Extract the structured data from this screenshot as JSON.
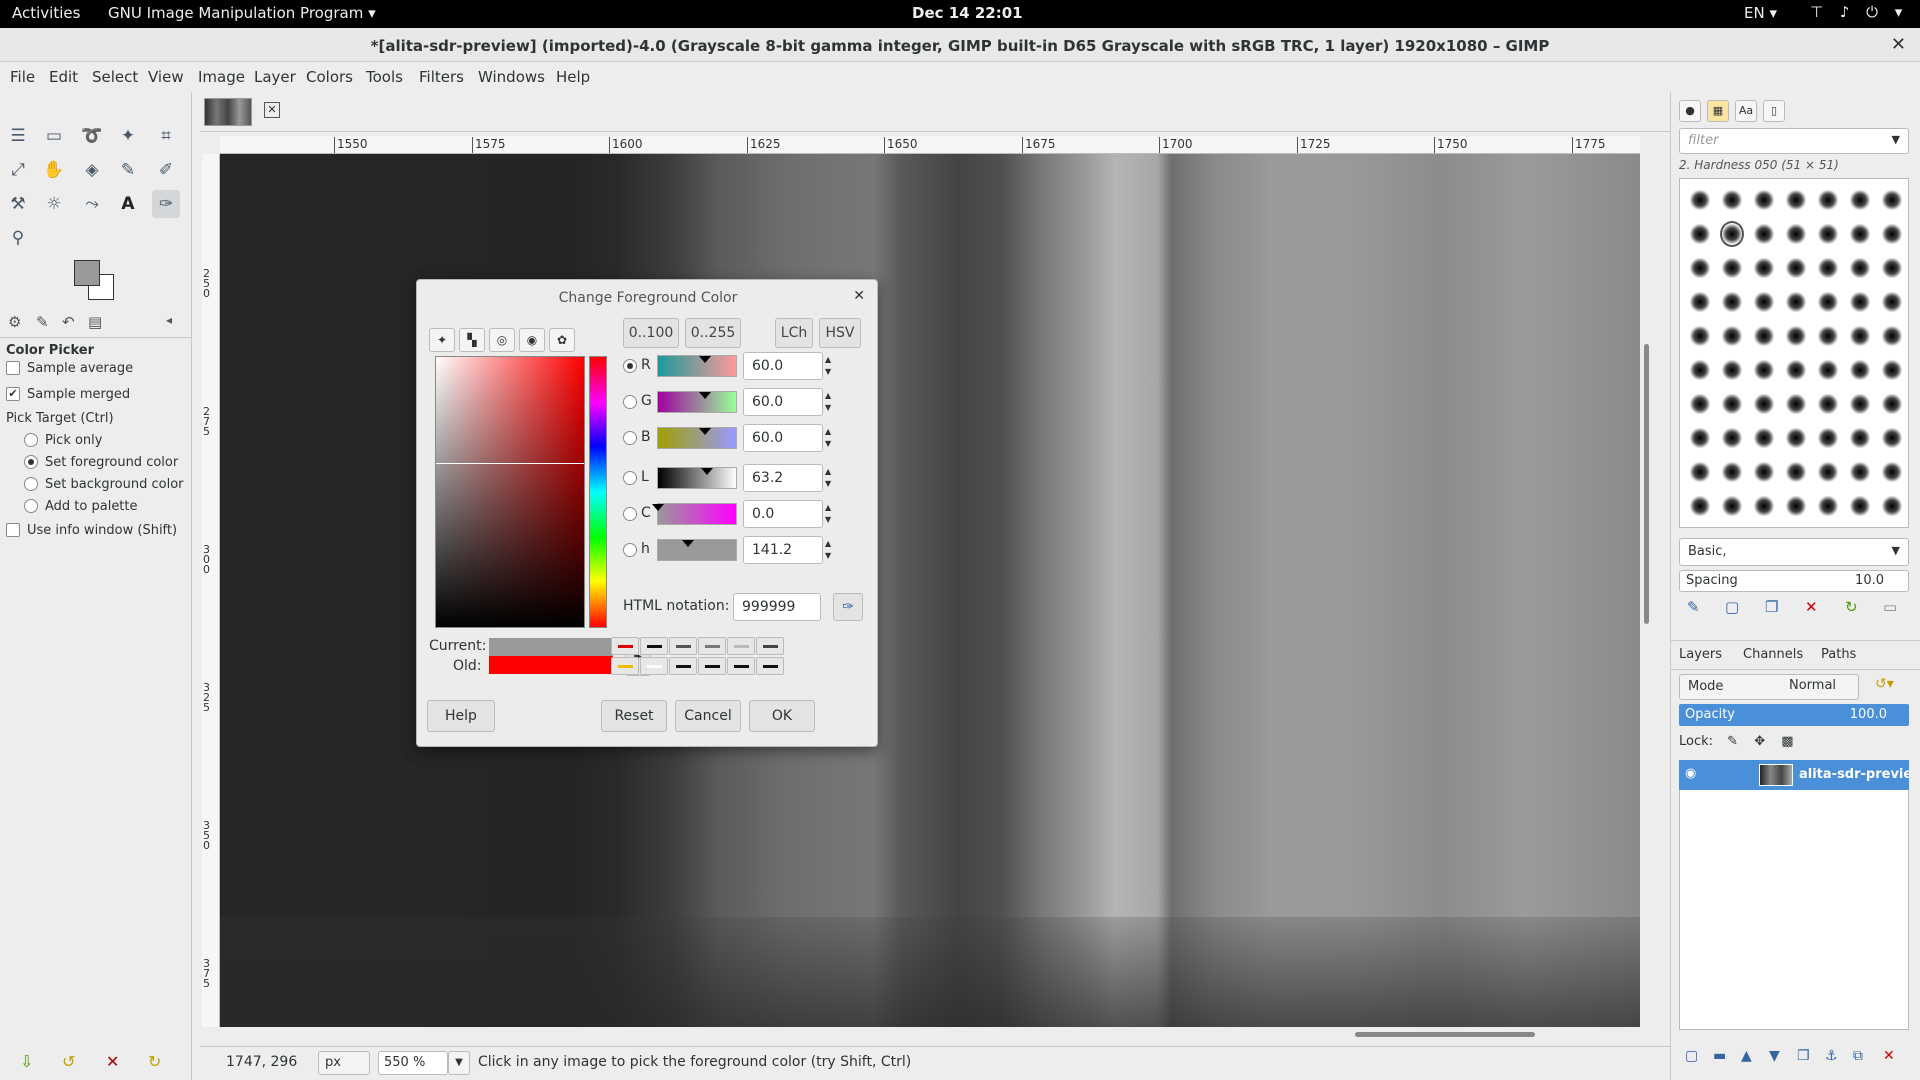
{
  "topbar": {
    "activities": "Activities",
    "app_menu": "GNU Image Manipulation Program ▾",
    "clock": "Dec 14  22:01",
    "lang": "EN ▾",
    "sys_icons": "⊤ ♪ ⏻ ▾"
  },
  "window": {
    "title": "*[alita-sdr-preview] (imported)-4.0 (Grayscale 8-bit gamma integer, GIMP built-in D65 Grayscale with sRGB TRC, 1 layer) 1920x1080 – GIMP",
    "close": "✕"
  },
  "menu": [
    "File",
    "Edit",
    "Select",
    "View",
    "Image",
    "Layer",
    "Colors",
    "Tools",
    "Filters",
    "Windows",
    "Help"
  ],
  "tool_options": {
    "title": "Color Picker",
    "sample_average": "Sample average",
    "sample_merged": "Sample merged",
    "pick_target": "Pick Target  (Ctrl)",
    "pick_only": "Pick only",
    "set_fg": "Set foreground color",
    "set_bg": "Set background color",
    "add_palette": "Add to palette",
    "use_info": "Use info window  (Shift)"
  },
  "ruler": {
    "h": [
      "1550",
      "1575",
      "1600",
      "1625",
      "1650",
      "1675",
      "1700",
      "1725",
      "1750",
      "1775"
    ],
    "v": [
      "250",
      "275",
      "300",
      "325",
      "350",
      "375"
    ]
  },
  "status": {
    "coords": "1747, 296",
    "unit": "px",
    "zoom": "550 %",
    "message": "Click in any image to pick the foreground color (try Shift, Ctrl)"
  },
  "brushes": {
    "filter_placeholder": "filter",
    "current": "2. Hardness 050 (51 × 51)",
    "preset": "Basic,",
    "spacing_label": "Spacing",
    "spacing_value": "10.0"
  },
  "layers": {
    "tabs": [
      "Layers",
      "Channels",
      "Paths"
    ],
    "mode_label": "Mode",
    "mode_value": "Normal",
    "opacity_label": "Opacity",
    "opacity_value": "100.0",
    "lock_label": "Lock:",
    "layer_name": "alita-sdr-preview.png"
  },
  "dialog": {
    "title": "Change Foreground Color",
    "scale_100": "0..100",
    "scale_255": "0..255",
    "lch": "LCh",
    "hsv": "HSV",
    "channels": [
      {
        "label": "R",
        "value": "60.0",
        "colors": [
          "#1a9b9b",
          "#ff9999"
        ],
        "marker_pct": 60
      },
      {
        "label": "G",
        "value": "60.0",
        "colors": [
          "#a000a0",
          "#99ff99"
        ],
        "marker_pct": 60
      },
      {
        "label": "B",
        "value": "60.0",
        "colors": [
          "#a0a000",
          "#9999ff"
        ],
        "marker_pct": 60
      },
      {
        "label": "L",
        "value": "63.2",
        "colors": [
          "#000000",
          "#ffffff"
        ],
        "marker_pct": 63
      },
      {
        "label": "C",
        "value": "0.0",
        "colors": [
          "#999999",
          "#ff00ff"
        ],
        "marker_pct": 0
      },
      {
        "label": "h",
        "value": "141.2",
        "colors": [
          "#999999",
          "#999999"
        ],
        "marker_pct": 39
      }
    ],
    "html_label": "HTML notation:",
    "html_value": "999999",
    "current_label": "Current:",
    "old_label": "Old:",
    "current_color": "#999999",
    "old_color": "#ff0000",
    "history_colors": [
      "#e00000",
      "#111111",
      "#555555",
      "#777777",
      "#bbbbbb",
      "#444444",
      "#e8c000",
      "#ffffff",
      "#111111",
      "#111111",
      "#111111",
      "#111111"
    ],
    "help": "Help",
    "reset": "Reset",
    "cancel": "Cancel",
    "ok": "OK"
  }
}
